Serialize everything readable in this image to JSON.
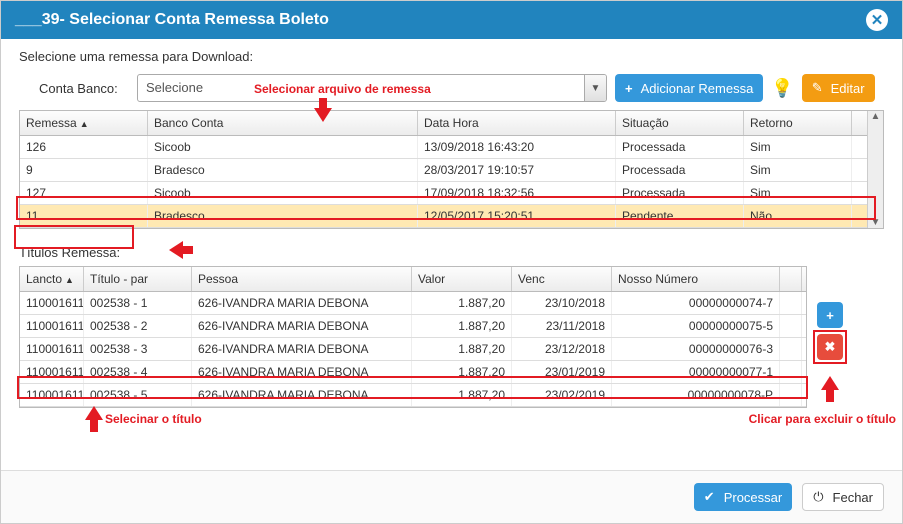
{
  "header": {
    "title": "___39- Selecionar Conta Remessa Boleto"
  },
  "instruction": "Selecione uma remessa para Download:",
  "form": {
    "label": "Conta Banco:",
    "select_text": "Selecione",
    "btn_add": "Adicionar Remessa",
    "btn_edit": "Editar"
  },
  "grid1": {
    "headers": {
      "c1": "Remessa",
      "c2": "Banco Conta",
      "c3": "Data Hora",
      "c4": "Situação",
      "c5": "Retorno"
    },
    "rows": [
      {
        "c1": "126",
        "c2": "Sicoob",
        "c3": "13/09/2018 16:43:20",
        "c4": "Processada",
        "c5": "Sim",
        "sel": false
      },
      {
        "c1": "9",
        "c2": "Bradesco",
        "c3": "28/03/2017 19:10:57",
        "c4": "Processada",
        "c5": "Sim",
        "sel": false
      },
      {
        "c1": "127",
        "c2": "Sicoob",
        "c3": "17/09/2018 18:32:56",
        "c4": "Processada",
        "c5": "Sim",
        "sel": false
      },
      {
        "c1": "11",
        "c2": "Bradesco",
        "c3": "12/05/2017 15:20:51",
        "c4": "Pendente",
        "c5": "Não",
        "sel": true
      }
    ]
  },
  "annotations": {
    "a1": "Selecionar arquivo de remessa",
    "a2": "Selecinar o título",
    "a3": "Clicar para excluir o título"
  },
  "section2_title": "Títulos Remessa:",
  "grid2": {
    "headers": {
      "d1": "Lancto",
      "d2": "Título - par",
      "d3": "Pessoa",
      "d4": "Valor",
      "d5": "Venc",
      "d6": "Nosso Número"
    },
    "rows": [
      {
        "d1": "110001611",
        "d2": "002538 - 1",
        "d3": "626-IVANDRA MARIA DEBONA",
        "d4": "1.887,20",
        "d5": "23/10/2018",
        "d6": "00000000074-7"
      },
      {
        "d1": "110001611",
        "d2": "002538 - 2",
        "d3": "626-IVANDRA MARIA DEBONA",
        "d4": "1.887,20",
        "d5": "23/11/2018",
        "d6": "00000000075-5"
      },
      {
        "d1": "110001611",
        "d2": "002538 - 3",
        "d3": "626-IVANDRA MARIA DEBONA",
        "d4": "1.887,20",
        "d5": "23/12/2018",
        "d6": "00000000076-3"
      },
      {
        "d1": "110001611",
        "d2": "002538 - 4",
        "d3": "626-IVANDRA MARIA DEBONA",
        "d4": "1.887,20",
        "d5": "23/01/2019",
        "d6": "00000000077-1"
      },
      {
        "d1": "110001611",
        "d2": "002538 - 5",
        "d3": "626-IVANDRA MARIA DEBONA",
        "d4": "1.887,20",
        "d5": "23/02/2019",
        "d6": "00000000078-P"
      }
    ]
  },
  "footer": {
    "btn_process": "Processar",
    "btn_close": "Fechar"
  }
}
